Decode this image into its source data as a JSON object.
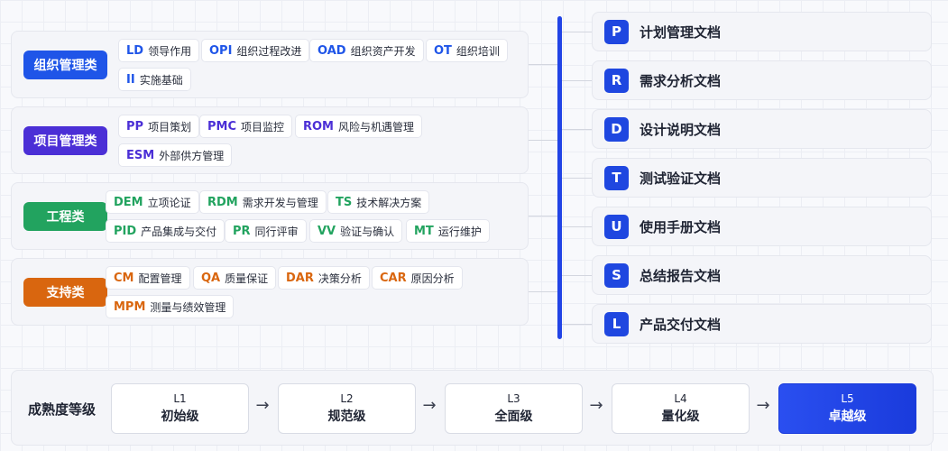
{
  "categories": [
    {
      "label": "组织管理类",
      "color": "#1f55e8",
      "items": [
        {
          "code": "LD",
          "name": "领导作用"
        },
        {
          "code": "OPI",
          "name": "组织过程改进"
        },
        {
          "code": "OAD",
          "name": "组织资产开发"
        },
        {
          "code": "OT",
          "name": "组织培训"
        },
        {
          "code": "II",
          "name": "实施基础"
        }
      ]
    },
    {
      "label": "项目管理类",
      "color": "#4b2fd6",
      "items": [
        {
          "code": "PP",
          "name": "项目策划"
        },
        {
          "code": "PMC",
          "name": "项目监控"
        },
        {
          "code": "ROM",
          "name": "风险与机遇管理"
        },
        {
          "code": "ESM",
          "name": "外部供方管理"
        }
      ]
    },
    {
      "label": "工程类",
      "color": "#22a35f",
      "items": [
        {
          "code": "DEM",
          "name": "立项论证"
        },
        {
          "code": "RDM",
          "name": "需求开发与管理"
        },
        {
          "code": "TS",
          "name": "技术解决方案"
        },
        {
          "code": "PID",
          "name": "产品集成与交付"
        },
        {
          "code": "PR",
          "name": "同行评审"
        },
        {
          "code": "VV",
          "name": "验证与确认"
        },
        {
          "code": "MT",
          "name": "运行维护"
        }
      ]
    },
    {
      "label": "支持类",
      "color": "#d9660f",
      "items": [
        {
          "code": "CM",
          "name": "配置管理"
        },
        {
          "code": "QA",
          "name": "质量保证"
        },
        {
          "code": "DAR",
          "name": "决策分析"
        },
        {
          "code": "CAR",
          "name": "原因分析"
        },
        {
          "code": "MPM",
          "name": "测量与绩效管理"
        }
      ]
    }
  ],
  "documents": [
    {
      "letter": "P",
      "title": "计划管理文档"
    },
    {
      "letter": "R",
      "title": "需求分析文档"
    },
    {
      "letter": "D",
      "title": "设计说明文档"
    },
    {
      "letter": "T",
      "title": "测试验证文档"
    },
    {
      "letter": "U",
      "title": "使用手册文档"
    },
    {
      "letter": "S",
      "title": "总结报告文档"
    },
    {
      "letter": "L",
      "title": "产品交付文档"
    }
  ],
  "maturity": {
    "label": "成熟度等级",
    "arrow": "→",
    "levels": [
      {
        "code": "L1",
        "name": "初始级"
      },
      {
        "code": "L2",
        "name": "规范级"
      },
      {
        "code": "L3",
        "name": "全面级"
      },
      {
        "code": "L4",
        "name": "量化级"
      },
      {
        "code": "L5",
        "name": "卓越级",
        "active": true
      }
    ]
  }
}
